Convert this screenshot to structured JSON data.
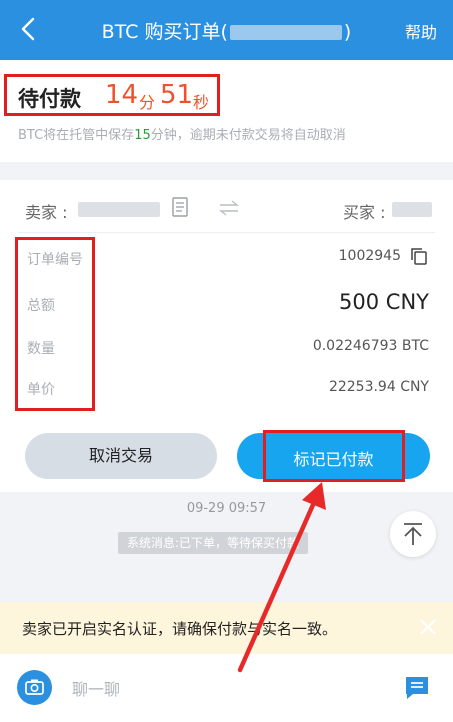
{
  "header": {
    "back_icon": "chevron-left-icon",
    "title": "BTC 购买订单(",
    "title_suffix": ")",
    "help_label": "帮助",
    "bg_color": "#2b90e0"
  },
  "status": {
    "pay_status": "待付款",
    "countdown_minutes": "14",
    "minute_unit": "分",
    "countdown_seconds": "51",
    "second_unit": "秒",
    "escrow_note_prefix": "BTC将在托管中保存",
    "escrow_minutes": "15",
    "escrow_note_suffix": "分钟，逾期未付款交易将自动取消"
  },
  "order": {
    "seller_label": "卖家 :",
    "buyer_label": "买家 :",
    "rows": [
      {
        "label": "订单编号",
        "value": "1002945"
      },
      {
        "label": "总额",
        "value": "500 CNY"
      },
      {
        "label": "数量",
        "value": "0.02246793 BTC"
      },
      {
        "label": "单价",
        "value": "22253.94 CNY"
      }
    ],
    "cancel_label": "取消交易",
    "paid_label": "标记已付款"
  },
  "chat": {
    "time": "09-29 09:57",
    "system_message": "系统消息:已下单，等待保买付款"
  },
  "notice": {
    "text": "卖家已开启实名认证，请确保付款与实名一致。"
  },
  "input": {
    "placeholder": "聊一聊"
  },
  "colors": {
    "accent": "#2b90e0",
    "countdown": "#f0512d",
    "highlight_frame": "#e02020",
    "primary_button": "#16a5ee"
  }
}
